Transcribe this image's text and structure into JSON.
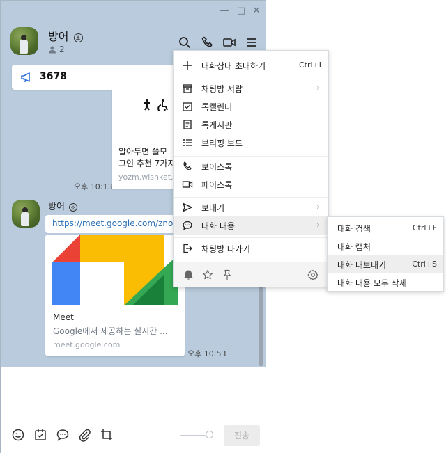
{
  "window": {
    "title_bar": {
      "minimize": "—",
      "maximize": "□",
      "close": "✕"
    },
    "chat": {
      "title": "방어",
      "badge": "소",
      "member_count": "2"
    }
  },
  "notice": {
    "text": "3678"
  },
  "messages": [
    {
      "card_title_line1": "알아두면 쓸모",
      "card_title_line2": "그인 추천 7가지",
      "card_url": "yozm.wishket.c",
      "time": "오후 10:13"
    },
    {
      "sender": "방어",
      "badge": "소",
      "link": "https://meet.google.com/zno-dv",
      "card_title": "Meet",
      "card_desc": "Google에서 제공하는 실시간 ...",
      "card_url": "meet.google.com",
      "time": "오후 10:53"
    }
  ],
  "input": {
    "send_label": "전송"
  },
  "menu": {
    "items": [
      {
        "label": "대화상대 초대하기",
        "shortcut": "Ctrl+I",
        "icon": "plus-icon"
      },
      {
        "label": "채팅방 서랍",
        "arrow": "›",
        "icon": "drawer-icon"
      },
      {
        "label": "톡캘린더",
        "icon": "calendar-check-icon"
      },
      {
        "label": "톡게시판",
        "icon": "board-icon"
      },
      {
        "label": "브리핑 보드",
        "icon": "list-icon"
      },
      {
        "label": "보이스톡",
        "icon": "phone-icon"
      },
      {
        "label": "페이스톡",
        "icon": "video-icon"
      },
      {
        "label": "보내기",
        "arrow": "›",
        "icon": "send-icon"
      },
      {
        "label": "대화 내용",
        "arrow": "›",
        "icon": "chat-bubble-icon"
      },
      {
        "label": "채팅방 나가기",
        "icon": "exit-icon"
      }
    ]
  },
  "submenu": {
    "items": [
      {
        "label": "대화 검색",
        "shortcut": "Ctrl+F"
      },
      {
        "label": "대화 캡처",
        "shortcut": ""
      },
      {
        "label": "대화 내보내기",
        "shortcut": "Ctrl+S"
      },
      {
        "label": "대화 내용 모두 삭제",
        "shortcut": ""
      }
    ]
  },
  "colors": {
    "chat_background": "#b9cbdc",
    "link": "#2a6fb5",
    "menu_highlight": "#eeeeee",
    "meet_red": "#ea4335",
    "meet_blue": "#4285f4",
    "meet_yellow": "#fbbc04",
    "meet_green": "#34a853"
  }
}
